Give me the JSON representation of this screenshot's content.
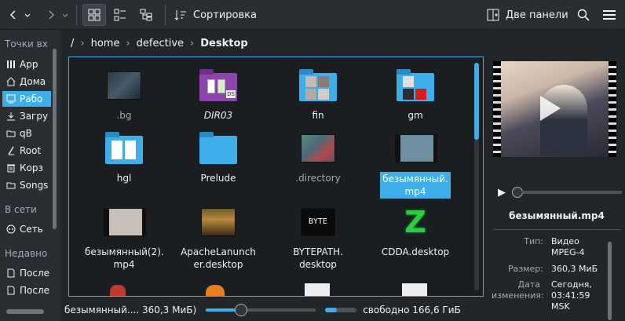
{
  "toolbar": {
    "sort_label": "Сортировка",
    "split_label": "Две панели",
    "icons": [
      "back-icon",
      "forward-icon",
      "icons-view-icon",
      "details-view-icon",
      "tree-view-icon",
      "sort-icon",
      "split-panel-icon",
      "search-icon",
      "menu-icon"
    ]
  },
  "sidebar": {
    "places_header": "Точки вх",
    "places": [
      {
        "label": "App",
        "icon": "bookmark-icon"
      },
      {
        "label": "Дома",
        "icon": "home-icon"
      },
      {
        "label": "Рабо",
        "icon": "desktop-icon",
        "selected": true
      },
      {
        "label": "Загру",
        "icon": "download-icon"
      },
      {
        "label": "qB",
        "icon": "folder-icon"
      },
      {
        "label": "Root",
        "icon": "root-icon"
      },
      {
        "label": "Корз",
        "icon": "trash-icon"
      },
      {
        "label": "Songs",
        "icon": "folder-icon"
      }
    ],
    "network_header": "В сети",
    "network": [
      {
        "label": "Сеть",
        "icon": "network-icon"
      }
    ],
    "recent_header": "Недавно",
    "recent": [
      {
        "label": "После",
        "icon": "document-icon"
      },
      {
        "label": "После",
        "icon": "document-icon"
      }
    ]
  },
  "breadcrumb": {
    "root": "/",
    "parts": [
      "home",
      "defective"
    ],
    "current": "Desktop"
  },
  "files": [
    {
      "name": ".bg",
      "kind": "thumb-dark",
      "dim": true
    },
    {
      "name": "DIR03",
      "kind": "folder-purple",
      "italic": true
    },
    {
      "name": "fin",
      "kind": "folder-thumb"
    },
    {
      "name": "gm",
      "kind": "folder-thumb-red"
    },
    {
      "name": "hgl",
      "kind": "folder-docs"
    },
    {
      "name": "Prelude",
      "kind": "folder"
    },
    {
      "name": ".directory",
      "kind": "thumb-gradient",
      "dim": true
    },
    {
      "name": "безымянный.\nmp4",
      "kind": "video",
      "selected": true
    },
    {
      "name": "безымянный(2).\nmp4",
      "kind": "video"
    },
    {
      "name": "ApacheLanuncher.desktop",
      "kind": "apache"
    },
    {
      "name": "BYTEPATH.\ndesktop",
      "kind": "byte"
    },
    {
      "name": "CDDA.desktop",
      "kind": "cdda"
    }
  ],
  "preview": {
    "title": "безымянный.mp4",
    "fields": [
      {
        "key": "Тип:",
        "value": "Видео MPEG-4"
      },
      {
        "key": "Размер:",
        "value": "360,3 МиБ"
      },
      {
        "key": "Дата изменения:",
        "value": "Сегодня, 03:41:59 MSK"
      }
    ]
  },
  "status": {
    "selection": "безымянный.... 360,3 МиБ)",
    "zoom_fraction": 0.32,
    "free": "свободно 166,6 ГиБ",
    "used_fraction": 0.12
  }
}
